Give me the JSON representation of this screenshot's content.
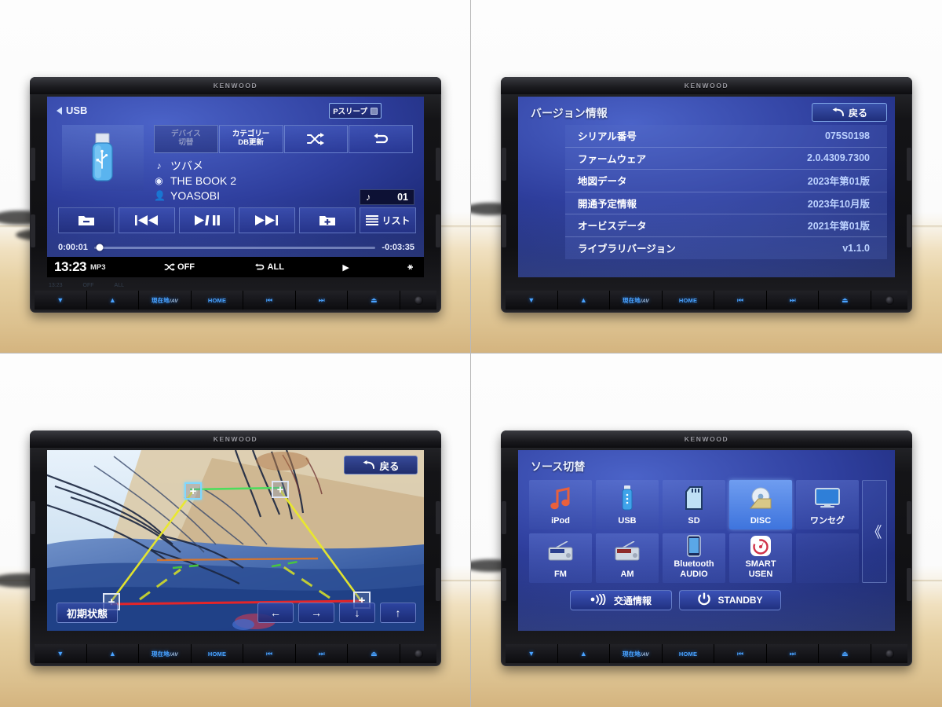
{
  "brand": "KENWOOD",
  "hardware_buttons": [
    {
      "name": "volume-down",
      "glyph": "▼",
      "label": ""
    },
    {
      "name": "volume-up",
      "glyph": "▲",
      "label": ""
    },
    {
      "name": "current-location-av",
      "glyph": "",
      "label": "現在地",
      "sub": "/AV"
    },
    {
      "name": "home",
      "glyph": "",
      "label": "HOME"
    },
    {
      "name": "track-previous",
      "glyph": "⏮",
      "label": ""
    },
    {
      "name": "track-next",
      "glyph": "⏭",
      "label": ""
    },
    {
      "name": "eject",
      "glyph": "⏏",
      "label": ""
    },
    {
      "name": "camera-lens",
      "glyph": "",
      "label": ""
    }
  ],
  "panel_usb": {
    "source_label": "USB",
    "park_sleep_label": "Pスリープ",
    "top_buttons": [
      {
        "label_line1": "デバイス",
        "label_line2": "切替",
        "state": "disabled"
      },
      {
        "label_line1": "カテゴリー",
        "label_line2": "DB更新",
        "state": "enabled"
      },
      {
        "icon": "shuffle-icon",
        "state": "enabled"
      },
      {
        "icon": "repeat-icon",
        "state": "enabled"
      }
    ],
    "track": {
      "title": "ツバメ",
      "album": "THE BOOK 2",
      "artist": "YOASOBI",
      "track_number": "01"
    },
    "transport": [
      {
        "name": "folder-down-button",
        "glyph": "folder-minus-icon"
      },
      {
        "name": "previous-button",
        "glyph": "prev-icon"
      },
      {
        "name": "play-pause-button",
        "glyph": "▶/❘❘"
      },
      {
        "name": "next-button",
        "glyph": "next-icon"
      },
      {
        "name": "folder-up-button",
        "glyph": "folder-plus-icon"
      },
      {
        "name": "list-button",
        "glyph": "list-icon",
        "label": "リスト"
      }
    ],
    "elapsed": "0:00:01",
    "remaining": "-0:03:35",
    "progress_percent": 2,
    "status_bar": {
      "clock": "13:23",
      "format": "MP3",
      "shuffle": "OFF",
      "repeat": "ALL",
      "play_state": "▶",
      "bluetooth": "bluetooth-icon"
    }
  },
  "panel_version": {
    "title": "バージョン情報",
    "back_label": "戻る",
    "rows": [
      {
        "key": "シリアル番号",
        "value": "075S0198"
      },
      {
        "key": "ファームウェア",
        "value": "2.0.4309.7300"
      },
      {
        "key": "地図データ",
        "value": "2023年第01版"
      },
      {
        "key": "開通予定情報",
        "value": "2023年10月版"
      },
      {
        "key": "オービスデータ",
        "value": "2021年第01版"
      },
      {
        "key": "ライブラリバージョン",
        "value": "v1.1.0"
      }
    ]
  },
  "panel_camera": {
    "back_label": "戻る",
    "reset_label": "初期状態",
    "arrows": [
      {
        "name": "move-left-button",
        "glyph": "←"
      },
      {
        "name": "move-right-button",
        "glyph": "→"
      },
      {
        "name": "move-down-button",
        "glyph": "↓"
      },
      {
        "name": "move-up-button",
        "glyph": "↑"
      }
    ],
    "markers": [
      "+",
      "+",
      "+",
      "+"
    ]
  },
  "panel_source": {
    "title": "ソース切替",
    "tiles": [
      {
        "label": "iPod",
        "icon": "music-note-icon",
        "selected": false
      },
      {
        "label": "USB",
        "icon": "usb-stick-icon",
        "selected": false
      },
      {
        "label": "SD",
        "icon": "sd-card-icon",
        "selected": false
      },
      {
        "label": "DISC",
        "icon": "disc-icon",
        "selected": true
      },
      {
        "label": "ワンセグ",
        "icon": "tv-icon",
        "selected": false
      },
      {
        "label": "FM",
        "icon": "radio-icon",
        "selected": false
      },
      {
        "label": "AM",
        "icon": "radio-icon",
        "selected": false
      },
      {
        "label": "Bluetooth\nAUDIO",
        "label_line1": "Bluetooth",
        "label_line2": "AUDIO",
        "icon": "phone-icon",
        "selected": false
      },
      {
        "label": "SMART\nUSEN",
        "label_line1": "SMART",
        "label_line2": "USEN",
        "icon": "smart-usen-icon",
        "selected": false
      }
    ],
    "scroll_label": "《",
    "bottom_buttons": [
      {
        "label": "交通情報",
        "icon": "broadcast-icon"
      },
      {
        "label": "STANDBY",
        "icon": "power-icon"
      }
    ]
  },
  "colors": {
    "screen_blue": "#2f3f9e",
    "accent": "#6f9df0",
    "text": "#ffffff",
    "value_text": "#bcd2ff",
    "bezel": "#141417"
  }
}
